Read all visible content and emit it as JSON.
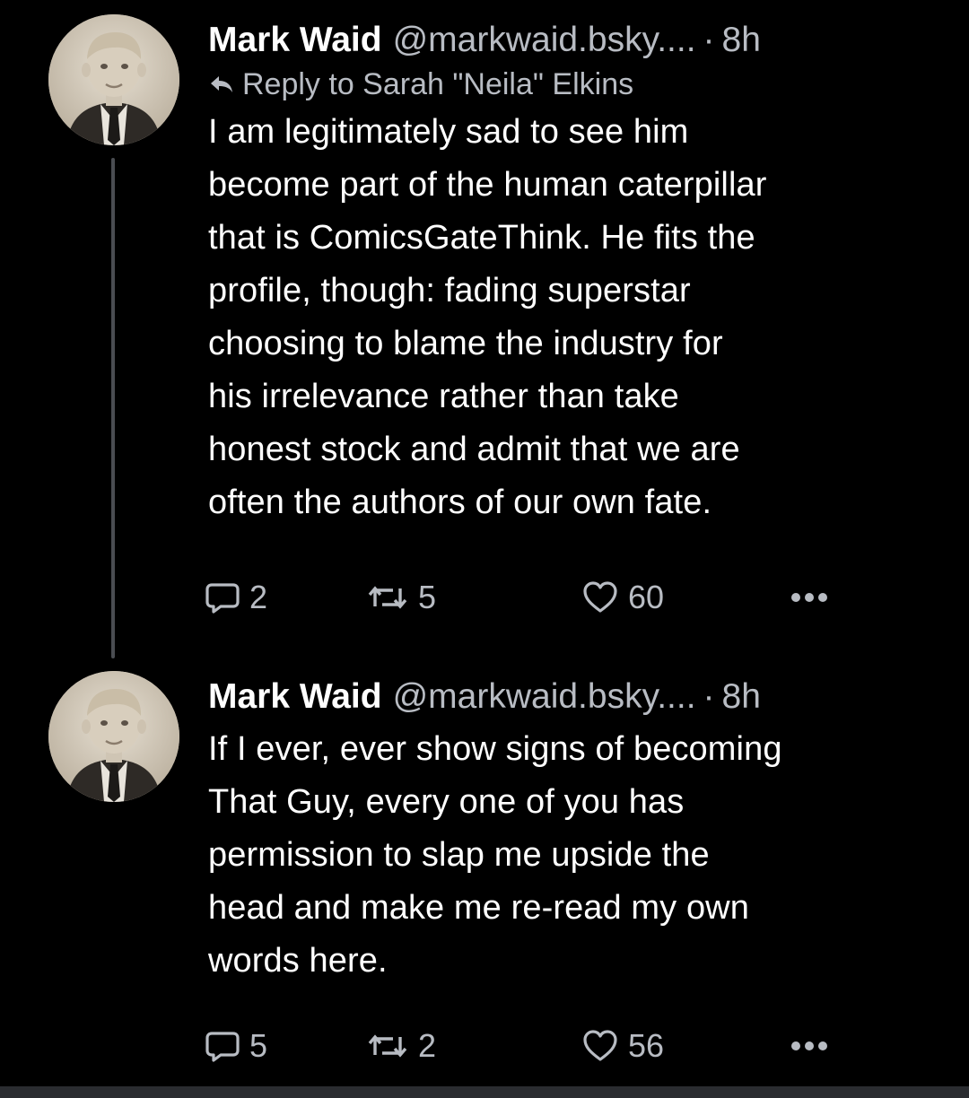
{
  "thread": {
    "posts": [
      {
        "author_name": "Mark Waid",
        "handle": "@markwaid.bsky....",
        "separator": "·",
        "time": "8h",
        "reply_to": "Reply to Sarah \"Neila\" Elkins",
        "body": "I am legitimately sad to see him\nbecome part of the human caterpillar\nthat is ComicsGateThink. He fits the\nprofile, though: fading superstar\nchoosing to blame the industry for\nhis irrelevance rather than take\nhonest stock and admit that we are\noften the authors of our own fate.",
        "reply_count": "2",
        "repost_count": "5",
        "like_count": "60"
      },
      {
        "author_name": "Mark Waid",
        "handle": "@markwaid.bsky....",
        "separator": "·",
        "time": "8h",
        "body": "If I ever, ever show signs of becoming\nThat Guy, every one of you has\npermission to slap me upside the\nhead and make me re-read my own\nwords here.",
        "reply_count": "5",
        "repost_count": "2",
        "like_count": "56"
      }
    ]
  },
  "colors": {
    "background": "#000000",
    "text": "#ffffff",
    "muted": "#b8bcc3",
    "thread_line": "#4a4d52"
  },
  "icons": {
    "reply": "reply-arrow-icon",
    "comment": "speech-bubble-icon",
    "repost": "repost-arrows-icon",
    "like": "heart-icon",
    "more": "ellipsis-icon"
  }
}
